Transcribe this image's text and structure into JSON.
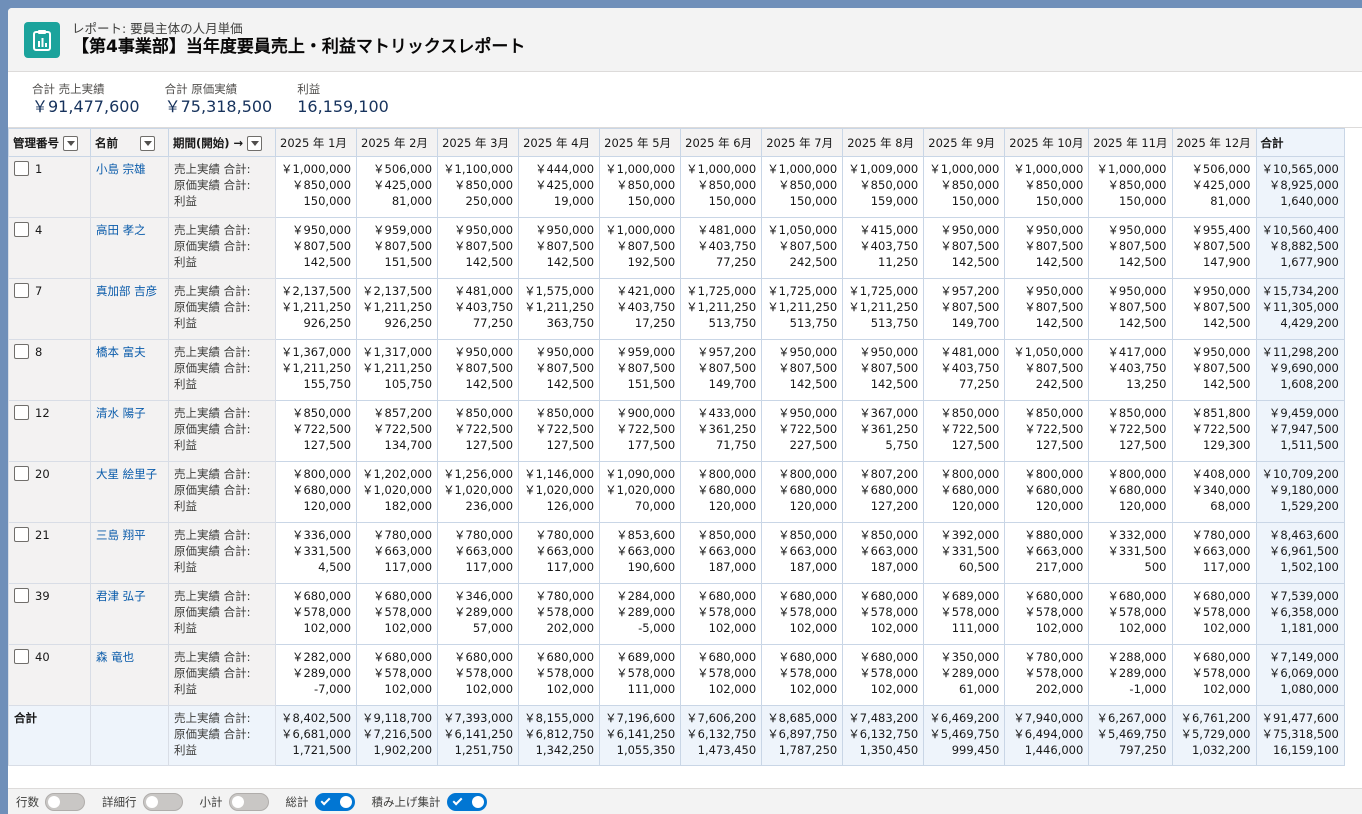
{
  "header": {
    "subtitle": "レポート: 要員主体の人月単価",
    "title": "【第4事業部】当年度要員売上・利益マトリックスレポート",
    "icon": "report-icon",
    "icon_color": "#1ba39c"
  },
  "summary": [
    {
      "label": "合計 売上実績",
      "value": "￥91,477,600"
    },
    {
      "label": "合計 原価実績",
      "value": "￥75,318,500"
    },
    {
      "label": "利益",
      "value": "16,159,100"
    }
  ],
  "columns": {
    "id": "管理番号",
    "name": "名前",
    "period": "期間(開始)",
    "period_arrow": "→",
    "months": [
      "2025 年 1月",
      "2025 年 2月",
      "2025 年 3月",
      "2025 年 4月",
      "2025 年 5月",
      "2025 年 6月",
      "2025 年 7月",
      "2025 年 8月",
      "2025 年 9月",
      "2025 年 10月",
      "2025 年 11月",
      "2025 年 12月"
    ],
    "total": "合計"
  },
  "measure_labels": [
    "売上実績 合計:",
    "原価実績 合計:",
    "利益"
  ],
  "rows": [
    {
      "id": "1",
      "name": "小島 宗雄",
      "sales": [
        "￥1,000,000",
        "￥506,000",
        "￥1,100,000",
        "￥444,000",
        "￥1,000,000",
        "￥1,000,000",
        "￥1,000,000",
        "￥1,009,000",
        "￥1,000,000",
        "￥1,000,000",
        "￥1,000,000",
        "￥506,000"
      ],
      "cost": [
        "￥850,000",
        "￥425,000",
        "￥850,000",
        "￥425,000",
        "￥850,000",
        "￥850,000",
        "￥850,000",
        "￥850,000",
        "￥850,000",
        "￥850,000",
        "￥850,000",
        "￥425,000"
      ],
      "profit": [
        "150,000",
        "81,000",
        "250,000",
        "19,000",
        "150,000",
        "150,000",
        "150,000",
        "159,000",
        "150,000",
        "150,000",
        "150,000",
        "81,000"
      ],
      "total": [
        "￥10,565,000",
        "￥8,925,000",
        "1,640,000"
      ]
    },
    {
      "id": "4",
      "name": "高田 孝之",
      "sales": [
        "￥950,000",
        "￥959,000",
        "￥950,000",
        "￥950,000",
        "￥1,000,000",
        "￥481,000",
        "￥1,050,000",
        "￥415,000",
        "￥950,000",
        "￥950,000",
        "￥950,000",
        "￥955,400"
      ],
      "cost": [
        "￥807,500",
        "￥807,500",
        "￥807,500",
        "￥807,500",
        "￥807,500",
        "￥403,750",
        "￥807,500",
        "￥403,750",
        "￥807,500",
        "￥807,500",
        "￥807,500",
        "￥807,500"
      ],
      "profit": [
        "142,500",
        "151,500",
        "142,500",
        "142,500",
        "192,500",
        "77,250",
        "242,500",
        "11,250",
        "142,500",
        "142,500",
        "142,500",
        "147,900"
      ],
      "total": [
        "￥10,560,400",
        "￥8,882,500",
        "1,677,900"
      ]
    },
    {
      "id": "7",
      "name": "真加部 吉彦",
      "sales": [
        "￥2,137,500",
        "￥2,137,500",
        "￥481,000",
        "￥1,575,000",
        "￥421,000",
        "￥1,725,000",
        "￥1,725,000",
        "￥1,725,000",
        "￥957,200",
        "￥950,000",
        "￥950,000",
        "￥950,000"
      ],
      "cost": [
        "￥1,211,250",
        "￥1,211,250",
        "￥403,750",
        "￥1,211,250",
        "￥403,750",
        "￥1,211,250",
        "￥1,211,250",
        "￥1,211,250",
        "￥807,500",
        "￥807,500",
        "￥807,500",
        "￥807,500"
      ],
      "profit": [
        "926,250",
        "926,250",
        "77,250",
        "363,750",
        "17,250",
        "513,750",
        "513,750",
        "513,750",
        "149,700",
        "142,500",
        "142,500",
        "142,500"
      ],
      "total": [
        "￥15,734,200",
        "￥11,305,000",
        "4,429,200"
      ]
    },
    {
      "id": "8",
      "name": "橋本 富夫",
      "sales": [
        "￥1,367,000",
        "￥1,317,000",
        "￥950,000",
        "￥950,000",
        "￥959,000",
        "￥957,200",
        "￥950,000",
        "￥950,000",
        "￥481,000",
        "￥1,050,000",
        "￥417,000",
        "￥950,000"
      ],
      "cost": [
        "￥1,211,250",
        "￥1,211,250",
        "￥807,500",
        "￥807,500",
        "￥807,500",
        "￥807,500",
        "￥807,500",
        "￥807,500",
        "￥403,750",
        "￥807,500",
        "￥403,750",
        "￥807,500"
      ],
      "profit": [
        "155,750",
        "105,750",
        "142,500",
        "142,500",
        "151,500",
        "149,700",
        "142,500",
        "142,500",
        "77,250",
        "242,500",
        "13,250",
        "142,500"
      ],
      "total": [
        "￥11,298,200",
        "￥9,690,000",
        "1,608,200"
      ]
    },
    {
      "id": "12",
      "name": "清水 陽子",
      "sales": [
        "￥850,000",
        "￥857,200",
        "￥850,000",
        "￥850,000",
        "￥900,000",
        "￥433,000",
        "￥950,000",
        "￥367,000",
        "￥850,000",
        "￥850,000",
        "￥850,000",
        "￥851,800"
      ],
      "cost": [
        "￥722,500",
        "￥722,500",
        "￥722,500",
        "￥722,500",
        "￥722,500",
        "￥361,250",
        "￥722,500",
        "￥361,250",
        "￥722,500",
        "￥722,500",
        "￥722,500",
        "￥722,500"
      ],
      "profit": [
        "127,500",
        "134,700",
        "127,500",
        "127,500",
        "177,500",
        "71,750",
        "227,500",
        "5,750",
        "127,500",
        "127,500",
        "127,500",
        "129,300"
      ],
      "total": [
        "￥9,459,000",
        "￥7,947,500",
        "1,511,500"
      ]
    },
    {
      "id": "20",
      "name": "大星 絵里子",
      "sales": [
        "￥800,000",
        "￥1,202,000",
        "￥1,256,000",
        "￥1,146,000",
        "￥1,090,000",
        "￥800,000",
        "￥800,000",
        "￥807,200",
        "￥800,000",
        "￥800,000",
        "￥800,000",
        "￥408,000"
      ],
      "cost": [
        "￥680,000",
        "￥1,020,000",
        "￥1,020,000",
        "￥1,020,000",
        "￥1,020,000",
        "￥680,000",
        "￥680,000",
        "￥680,000",
        "￥680,000",
        "￥680,000",
        "￥680,000",
        "￥340,000"
      ],
      "profit": [
        "120,000",
        "182,000",
        "236,000",
        "126,000",
        "70,000",
        "120,000",
        "120,000",
        "127,200",
        "120,000",
        "120,000",
        "120,000",
        "68,000"
      ],
      "total": [
        "￥10,709,200",
        "￥9,180,000",
        "1,529,200"
      ]
    },
    {
      "id": "21",
      "name": "三島 翔平",
      "sales": [
        "￥336,000",
        "￥780,000",
        "￥780,000",
        "￥780,000",
        "￥853,600",
        "￥850,000",
        "￥850,000",
        "￥850,000",
        "￥392,000",
        "￥880,000",
        "￥332,000",
        "￥780,000"
      ],
      "cost": [
        "￥331,500",
        "￥663,000",
        "￥663,000",
        "￥663,000",
        "￥663,000",
        "￥663,000",
        "￥663,000",
        "￥663,000",
        "￥331,500",
        "￥663,000",
        "￥331,500",
        "￥663,000"
      ],
      "profit": [
        "4,500",
        "117,000",
        "117,000",
        "117,000",
        "190,600",
        "187,000",
        "187,000",
        "187,000",
        "60,500",
        "217,000",
        "500",
        "117,000"
      ],
      "total": [
        "￥8,463,600",
        "￥6,961,500",
        "1,502,100"
      ]
    },
    {
      "id": "39",
      "name": "君津 弘子",
      "sales": [
        "￥680,000",
        "￥680,000",
        "￥346,000",
        "￥780,000",
        "￥284,000",
        "￥680,000",
        "￥680,000",
        "￥680,000",
        "￥689,000",
        "￥680,000",
        "￥680,000",
        "￥680,000"
      ],
      "cost": [
        "￥578,000",
        "￥578,000",
        "￥289,000",
        "￥578,000",
        "￥289,000",
        "￥578,000",
        "￥578,000",
        "￥578,000",
        "￥578,000",
        "￥578,000",
        "￥578,000",
        "￥578,000"
      ],
      "profit": [
        "102,000",
        "102,000",
        "57,000",
        "202,000",
        "-5,000",
        "102,000",
        "102,000",
        "102,000",
        "111,000",
        "102,000",
        "102,000",
        "102,000"
      ],
      "total": [
        "￥7,539,000",
        "￥6,358,000",
        "1,181,000"
      ]
    },
    {
      "id": "40",
      "name": "森 竜也",
      "sales": [
        "￥282,000",
        "￥680,000",
        "￥680,000",
        "￥680,000",
        "￥689,000",
        "￥680,000",
        "￥680,000",
        "￥680,000",
        "￥350,000",
        "￥780,000",
        "￥288,000",
        "￥680,000"
      ],
      "cost": [
        "￥289,000",
        "￥578,000",
        "￥578,000",
        "￥578,000",
        "￥578,000",
        "￥578,000",
        "￥578,000",
        "￥578,000",
        "￥289,000",
        "￥578,000",
        "￥289,000",
        "￥578,000"
      ],
      "profit": [
        "-7,000",
        "102,000",
        "102,000",
        "102,000",
        "111,000",
        "102,000",
        "102,000",
        "102,000",
        "61,000",
        "202,000",
        "-1,000",
        "102,000"
      ],
      "total": [
        "￥7,149,000",
        "￥6,069,000",
        "1,080,000"
      ]
    }
  ],
  "grand_total": {
    "label": "合計",
    "sales": [
      "￥8,402,500",
      "￥9,118,700",
      "￥7,393,000",
      "￥8,155,000",
      "￥7,196,600",
      "￥7,606,200",
      "￥8,685,000",
      "￥7,483,200",
      "￥6,469,200",
      "￥7,940,000",
      "￥6,267,000",
      "￥6,761,200"
    ],
    "cost": [
      "￥6,681,000",
      "￥7,216,500",
      "￥6,141,250",
      "￥6,812,750",
      "￥6,141,250",
      "￥6,132,750",
      "￥6,897,750",
      "￥6,132,750",
      "￥5,469,750",
      "￥6,494,000",
      "￥5,469,750",
      "￥5,729,000"
    ],
    "profit": [
      "1,721,500",
      "1,902,200",
      "1,251,750",
      "1,342,250",
      "1,055,350",
      "1,473,450",
      "1,787,250",
      "1,350,450",
      "999,450",
      "1,446,000",
      "797,250",
      "1,032,200"
    ],
    "total": [
      "￥91,477,600",
      "￥75,318,500",
      "16,159,100"
    ]
  },
  "footer": {
    "toggles": [
      {
        "label": "行数",
        "on": false
      },
      {
        "label": "詳細行",
        "on": false
      },
      {
        "label": "小計",
        "on": false
      },
      {
        "label": "総計",
        "on": true
      },
      {
        "label": "積み上げ集計",
        "on": true
      }
    ],
    "on_color": "#0176d3"
  }
}
